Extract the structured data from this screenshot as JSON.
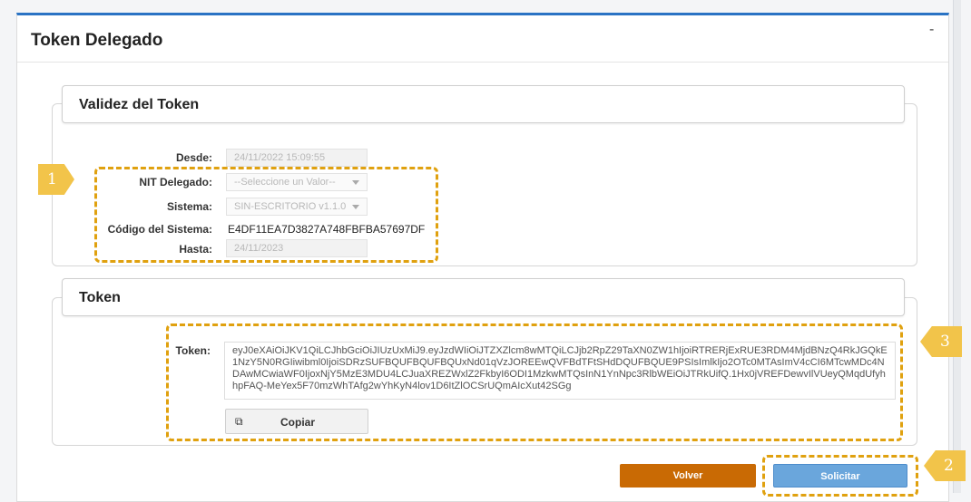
{
  "card": {
    "title": "Token Delegado",
    "collapse_label": "-"
  },
  "validez": {
    "title": "Validez del Token",
    "desde": {
      "label": "Desde:",
      "value": "24/11/2022 15:09:55"
    },
    "nit": {
      "label": "NIT Delegado:",
      "placeholder": "--Seleccione un Valor--"
    },
    "sistema": {
      "label": "Sistema:",
      "value": "SIN-ESCRITORIO v1.1.0"
    },
    "codigo": {
      "label": "Código del Sistema:",
      "value": "E4DF11EA7D3827A748FBFBA57697DF"
    },
    "hasta": {
      "label": "Hasta:",
      "value": "24/11/2023"
    }
  },
  "token": {
    "title": "Token",
    "label": "Token:",
    "value": "eyJ0eXAiOiJKV1QiLCJhbGciOiJIUzUxMiJ9.eyJzdWIiOiJTZXZlcm8wMTQiLCJjb2RpZ29TaXN0ZW1hIjoiRTRERjExRUE3RDM4MjdBNzQ4RkJGQkE1NzY5N0RGIiwibml0IjoiSDRzSUFBQUFBQUFBQUxNd01qVzJOREEwQVFBdTFtSHdDQUFBQUE9PSIsImlkIjo2OTc0MTAsImV4cCI6MTcwMDc4NDAwMCwiaWF0IjoxNjY5MzE3MDU4LCJuaXREZWxlZ2FkbyI6ODI1MzkwMTQsInN1YnNpc3RlbWEiOiJTRkUifQ.1Hx0jVREFDewvIlVUeyQMqdUfyhhpFAQ-MeYex5F70mzWhTAfg2wYhKyN4lov1D6ItZlOCSrUQmAIcXut42SGg",
    "copy_label": "Copiar",
    "copy_icon": "copy-icon"
  },
  "actions": {
    "volver": "Volver",
    "solicitar": "Solicitar"
  },
  "callouts": {
    "one": "1",
    "two": "2",
    "three": "3"
  },
  "colors": {
    "accent": "#2a73c4",
    "highlight": "#e0a10f",
    "callout": "#f2c44a",
    "volver": "#c96a04",
    "solicitar": "#6aa6dc"
  }
}
